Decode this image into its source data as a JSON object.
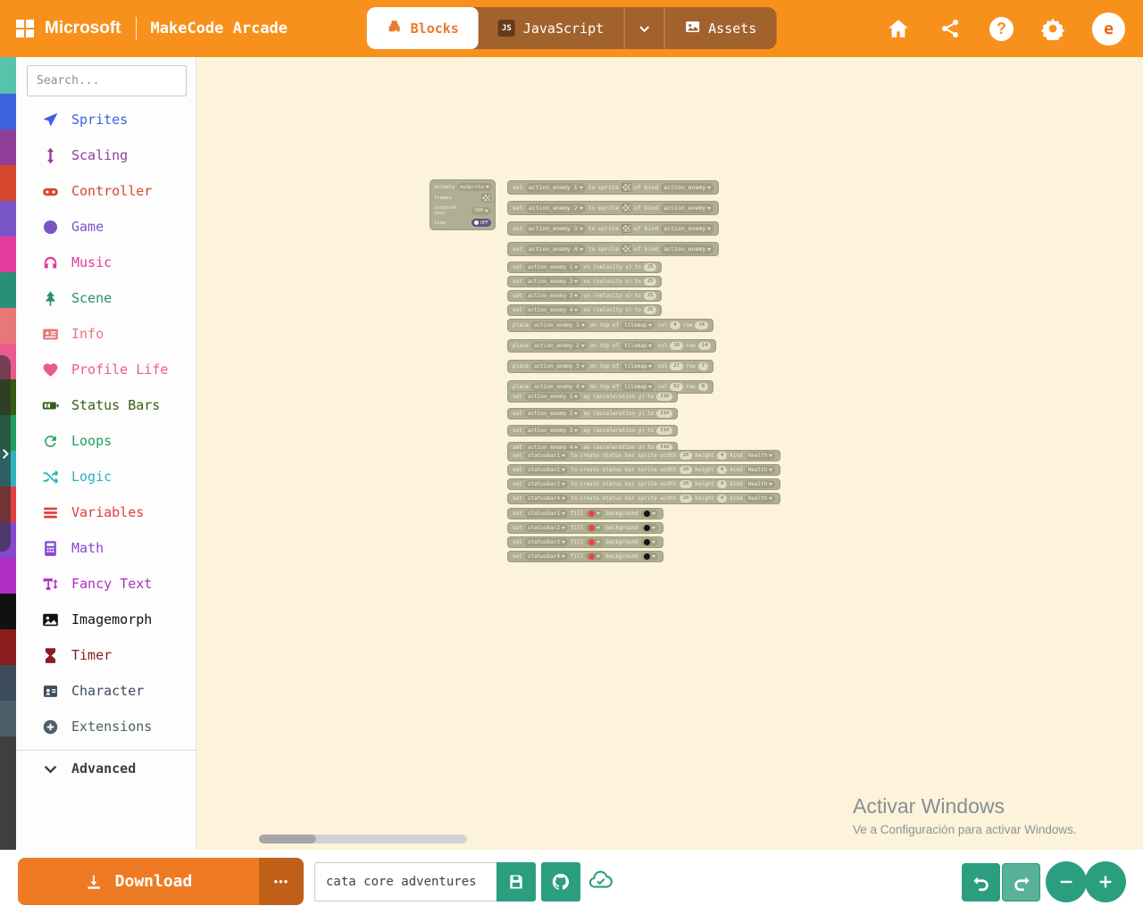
{
  "header": {
    "microsoft_label": "Microsoft",
    "product_label": "MakeCode Arcade",
    "tabs": [
      {
        "id": "blocks",
        "label": "Blocks",
        "active": true
      },
      {
        "id": "javascript",
        "label": "JavaScript",
        "active": false
      },
      {
        "id": "assets",
        "label": "Assets",
        "active": false
      }
    ],
    "js_badge": "JS",
    "help_glyph": "?",
    "avatar_initial": "e"
  },
  "toolbox": {
    "search_placeholder": "Search...",
    "advanced_label": "Advanced",
    "categories": [
      {
        "label": "Sprites",
        "color": "#3b63e0",
        "icon": "paper-plane"
      },
      {
        "label": "Scaling",
        "color": "#8f3f97",
        "icon": "resize-vertical"
      },
      {
        "label": "Controller",
        "color": "#d5482d",
        "icon": "gamepad"
      },
      {
        "label": "Game",
        "color": "#7a55c7",
        "icon": "circle"
      },
      {
        "label": "Music",
        "color": "#e23a9d",
        "icon": "headphones"
      },
      {
        "label": "Scene",
        "color": "#2a8f78",
        "icon": "tree"
      },
      {
        "label": "Info",
        "color": "#e87878",
        "icon": "id-card"
      },
      {
        "label": "Profile Life",
        "color": "#ea5a8e",
        "icon": "heart"
      },
      {
        "label": "Status Bars",
        "color": "#355e14",
        "icon": "battery"
      },
      {
        "label": "Loops",
        "color": "#1fa25f",
        "icon": "redo"
      },
      {
        "label": "Logic",
        "color": "#2fb3be",
        "icon": "shuffle"
      },
      {
        "label": "Variables",
        "color": "#df3f3f",
        "icon": "bars"
      },
      {
        "label": "Math",
        "color": "#8549ce",
        "icon": "calculator"
      },
      {
        "label": "Fancy Text",
        "color": "#b02fc4",
        "icon": "text-height"
      },
      {
        "label": "Imagemorph",
        "color": "#111111",
        "icon": "image"
      },
      {
        "label": "Timer",
        "color": "#8a1d1d",
        "icon": "hourglass"
      },
      {
        "label": "Character",
        "color": "#3d4c5a",
        "icon": "portrait"
      },
      {
        "label": "Extensions",
        "color": "#4a5f66",
        "icon": "plus-circle"
      }
    ]
  },
  "workspace": {
    "animate_rows": [
      [
        [
          "t",
          "animate"
        ],
        [
          "d",
          "mySprite"
        ]
      ],
      [
        [
          "t",
          "frames"
        ],
        [
          "i"
        ]
      ],
      [
        [
          "t",
          "interval (ms)"
        ],
        [
          "d",
          "200"
        ]
      ],
      [
        [
          "t",
          "loop"
        ],
        [
          "g",
          "OFF"
        ]
      ]
    ],
    "sprite_rows": [
      [
        [
          "t",
          "set"
        ],
        [
          "d",
          "action_enemy 1"
        ],
        [
          "t",
          "to"
        ],
        [
          "t",
          "sprite"
        ],
        [
          "i"
        ],
        [
          "t",
          "of kind"
        ],
        [
          "d",
          "action_enemy"
        ]
      ],
      [
        [
          "t",
          "set"
        ],
        [
          "d",
          "action_enemy 2"
        ],
        [
          "t",
          "to"
        ],
        [
          "t",
          "sprite"
        ],
        [
          "i"
        ],
        [
          "t",
          "of kind"
        ],
        [
          "d",
          "action_enemy"
        ]
      ],
      [
        [
          "t",
          "set"
        ],
        [
          "d",
          "action_enemy 3"
        ],
        [
          "t",
          "to"
        ],
        [
          "t",
          "sprite"
        ],
        [
          "i"
        ],
        [
          "t",
          "of kind"
        ],
        [
          "d",
          "action_enemy"
        ]
      ],
      [
        [
          "t",
          "set"
        ],
        [
          "d",
          "action_enemy 4"
        ],
        [
          "t",
          "to"
        ],
        [
          "t",
          "sprite"
        ],
        [
          "i"
        ],
        [
          "t",
          "of kind"
        ],
        [
          "d",
          "action_enemy"
        ]
      ]
    ],
    "velocity_rows": [
      [
        [
          "t",
          "set"
        ],
        [
          "d",
          "action_enemy 1"
        ],
        [
          "t",
          "vx (velocity x)"
        ],
        [
          "t",
          "to"
        ],
        [
          "n",
          "25"
        ]
      ],
      [
        [
          "t",
          "set"
        ],
        [
          "d",
          "action_enemy 2"
        ],
        [
          "t",
          "vx (velocity x)"
        ],
        [
          "t",
          "to"
        ],
        [
          "n",
          "25"
        ]
      ],
      [
        [
          "t",
          "set"
        ],
        [
          "d",
          "action_enemy 3"
        ],
        [
          "t",
          "vx (velocity x)"
        ],
        [
          "t",
          "to"
        ],
        [
          "n",
          "25"
        ]
      ],
      [
        [
          "t",
          "set"
        ],
        [
          "d",
          "action_enemy 4"
        ],
        [
          "t",
          "vx (velocity x)"
        ],
        [
          "t",
          "to"
        ],
        [
          "n",
          "25"
        ]
      ]
    ],
    "place_rows": [
      [
        [
          "t",
          "place"
        ],
        [
          "d",
          "action_enemy 1"
        ],
        [
          "t",
          "on top of"
        ],
        [
          "d",
          "tilemap"
        ],
        [
          "t",
          "col"
        ],
        [
          "n",
          "4"
        ],
        [
          "t",
          "row"
        ],
        [
          "n",
          "14"
        ]
      ],
      [
        [
          "t",
          "place"
        ],
        [
          "d",
          "action_enemy 2"
        ],
        [
          "t",
          "on top of"
        ],
        [
          "d",
          "tilemap"
        ],
        [
          "t",
          "col"
        ],
        [
          "n",
          "10"
        ],
        [
          "t",
          "row"
        ],
        [
          "n",
          "14"
        ]
      ],
      [
        [
          "t",
          "place"
        ],
        [
          "d",
          "action_enemy 3"
        ],
        [
          "t",
          "on top of"
        ],
        [
          "d",
          "tilemap"
        ],
        [
          "t",
          "col"
        ],
        [
          "n",
          "27"
        ],
        [
          "t",
          "row"
        ],
        [
          "n",
          "7"
        ]
      ],
      [
        [
          "t",
          "place"
        ],
        [
          "d",
          "action_enemy 4"
        ],
        [
          "t",
          "on top of"
        ],
        [
          "d",
          "tilemap"
        ],
        [
          "t",
          "col"
        ],
        [
          "n",
          "62"
        ],
        [
          "t",
          "row"
        ],
        [
          "n",
          "8"
        ]
      ]
    ],
    "accel_rows": [
      [
        [
          "t",
          "set"
        ],
        [
          "d",
          "action_enemy 1"
        ],
        [
          "t",
          "ay (acceleration y)"
        ],
        [
          "t",
          "to"
        ],
        [
          "n",
          "310"
        ]
      ],
      [
        [
          "t",
          "set"
        ],
        [
          "d",
          "action_enemy 2"
        ],
        [
          "t",
          "ay (acceleration y)"
        ],
        [
          "t",
          "to"
        ],
        [
          "n",
          "310"
        ]
      ],
      [
        [
          "t",
          "set"
        ],
        [
          "d",
          "action_enemy 3"
        ],
        [
          "t",
          "ay (acceleration y)"
        ],
        [
          "t",
          "to"
        ],
        [
          "n",
          "310"
        ]
      ],
      [
        [
          "t",
          "set"
        ],
        [
          "d",
          "action_enemy 4"
        ],
        [
          "t",
          "ay (acceleration y)"
        ],
        [
          "t",
          "to"
        ],
        [
          "n",
          "310"
        ]
      ]
    ],
    "statusbar_create_rows": [
      [
        [
          "t",
          "set"
        ],
        [
          "d",
          "statusbar1"
        ],
        [
          "t",
          "to"
        ],
        [
          "t",
          "create status bar sprite width"
        ],
        [
          "n",
          "20"
        ],
        [
          "t",
          "height"
        ],
        [
          "n",
          "4"
        ],
        [
          "t",
          "kind"
        ],
        [
          "d",
          "Health"
        ]
      ],
      [
        [
          "t",
          "set"
        ],
        [
          "d",
          "statusbar2"
        ],
        [
          "t",
          "to"
        ],
        [
          "t",
          "create status bar sprite width"
        ],
        [
          "n",
          "20"
        ],
        [
          "t",
          "height"
        ],
        [
          "n",
          "4"
        ],
        [
          "t",
          "kind"
        ],
        [
          "d",
          "Health"
        ]
      ],
      [
        [
          "t",
          "set"
        ],
        [
          "d",
          "statusbar3"
        ],
        [
          "t",
          "to"
        ],
        [
          "t",
          "create status bar sprite width"
        ],
        [
          "n",
          "20"
        ],
        [
          "t",
          "height"
        ],
        [
          "n",
          "4"
        ],
        [
          "t",
          "kind"
        ],
        [
          "d",
          "Health"
        ]
      ],
      [
        [
          "t",
          "set"
        ],
        [
          "d",
          "statusbar4"
        ],
        [
          "t",
          "to"
        ],
        [
          "t",
          "create status bar sprite width"
        ],
        [
          "n",
          "20"
        ],
        [
          "t",
          "height"
        ],
        [
          "n",
          "4"
        ],
        [
          "t",
          "kind"
        ],
        [
          "d",
          "Health"
        ]
      ]
    ],
    "statusbar_fill_rows": [
      [
        [
          "t",
          "set"
        ],
        [
          "d",
          "statusbar1"
        ],
        [
          "t",
          "fill"
        ],
        [
          "c",
          "#e84545"
        ],
        [
          "t",
          "background"
        ],
        [
          "c",
          "#141414"
        ]
      ],
      [
        [
          "t",
          "set"
        ],
        [
          "d",
          "statusbar2"
        ],
        [
          "t",
          "fill"
        ],
        [
          "c",
          "#e84545"
        ],
        [
          "t",
          "background"
        ],
        [
          "c",
          "#141414"
        ]
      ],
      [
        [
          "t",
          "set"
        ],
        [
          "d",
          "statusbar3"
        ],
        [
          "t",
          "fill"
        ],
        [
          "c",
          "#e84545"
        ],
        [
          "t",
          "background"
        ],
        [
          "c",
          "#141414"
        ]
      ],
      [
        [
          "t",
          "set"
        ],
        [
          "d",
          "statusbar4"
        ],
        [
          "t",
          "fill"
        ],
        [
          "c",
          "#e84545"
        ],
        [
          "t",
          "background"
        ],
        [
          "c",
          "#141414"
        ]
      ]
    ]
  },
  "watermark": {
    "title": "Activar Windows",
    "subtitle": "Ve a Configuración para activar Windows."
  },
  "footer": {
    "download_label": "Download",
    "more_label": "•••",
    "project_name": "cata core adventures"
  },
  "colors": {
    "header_orange": "#f8911c",
    "teal_button": "#2b9e80",
    "download_orange": "#ee7b23",
    "workspace_cream": "#fdf3da",
    "disabled_block_gray": "#b1af93"
  }
}
